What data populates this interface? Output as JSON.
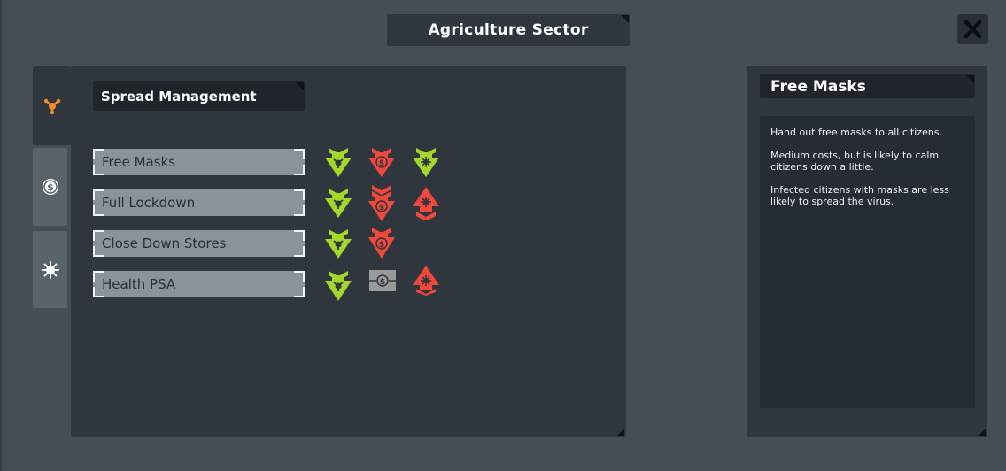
{
  "window": {
    "title": "Agriculture Sector",
    "close_icon": "close-icon"
  },
  "tabs": [
    {
      "name": "spread",
      "icon": "spread-icon",
      "active": true
    },
    {
      "name": "economy",
      "icon": "dollar-coin-icon",
      "active": false
    },
    {
      "name": "virus",
      "icon": "virus-icon",
      "active": false
    }
  ],
  "section": {
    "title": "Spread Management"
  },
  "policies": [
    {
      "label": "Free Masks",
      "effects": [
        "spread-down-green",
        "money-down-red",
        "virus-down-green"
      ]
    },
    {
      "label": "Full Lockdown",
      "effects": [
        "spread-down-green",
        "money-down-red",
        "virus-up-red"
      ]
    },
    {
      "label": "Close Down Stores",
      "effects": [
        "spread-down-green",
        "money-down-red"
      ]
    },
    {
      "label": "Health PSA",
      "effects": [
        "spread-down-green",
        "money-neutral-gray",
        "virus-up-red"
      ]
    }
  ],
  "info": {
    "title": "Free Masks",
    "paragraphs": [
      "Hand out free masks to all citizens.",
      "Medium costs, but is likely to calm citizens down a little.",
      "Infected citizens with masks are less likely to spread the virus."
    ]
  },
  "colors": {
    "green": "#a3d82b",
    "red": "#f0483a",
    "gray": "#9a9a9a",
    "accent_orange": "#f28c2a"
  }
}
